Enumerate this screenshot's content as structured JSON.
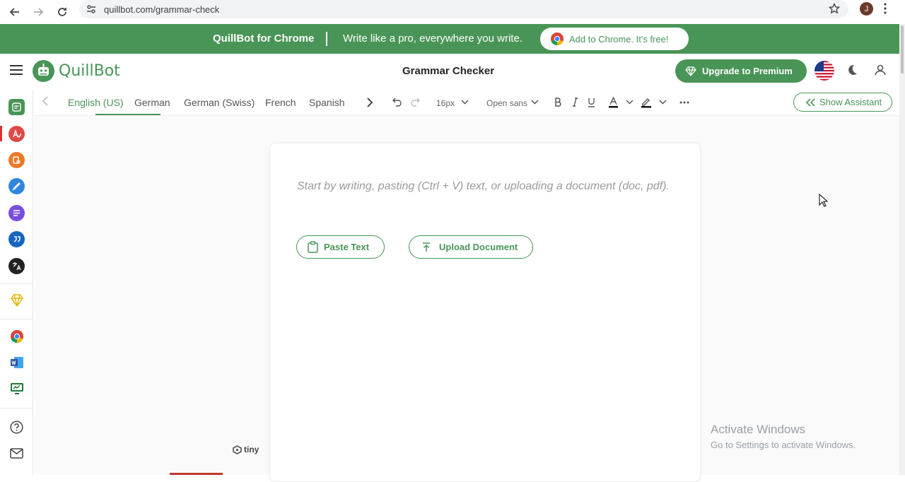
{
  "browser": {
    "url": "quillbot.com/grammar-check",
    "profile_initial": "J"
  },
  "promo": {
    "title": "QuillBot for Chrome",
    "tagline": "Write like a pro, everywhere you write.",
    "cta_label": "Add to Chrome. It's free!"
  },
  "header": {
    "brand": "QuillBot",
    "page_title": "Grammar Checker",
    "upgrade_label": "Upgrade to Premium"
  },
  "sidebar": {
    "items": [
      {
        "icon": "paraphraser-icon",
        "color": "#499557"
      },
      {
        "icon": "grammar-checker-icon",
        "color": "#e04848"
      },
      {
        "icon": "plagiarism-checker-icon",
        "color": "#ea7a27"
      },
      {
        "icon": "co-writer-icon",
        "color": "#2f86e0"
      },
      {
        "icon": "summarizer-icon",
        "color": "#7a4ee0"
      },
      {
        "icon": "citation-generator-icon",
        "color": "#1565c0"
      },
      {
        "icon": "translator-icon",
        "color": "#222222"
      },
      {
        "icon": "premium-gem-icon",
        "color": "#e7b400"
      },
      {
        "icon": "chrome-extension-icon",
        "color": "#e04848"
      },
      {
        "icon": "word-addin-icon",
        "color": "#2b579a"
      },
      {
        "icon": "desktop-app-icon",
        "color": "#1e7b34"
      },
      {
        "icon": "help-icon",
        "color": "#444444"
      },
      {
        "icon": "mail-icon",
        "color": "#444444"
      }
    ]
  },
  "toolbar": {
    "languages": [
      "English (US)",
      "German",
      "German (Swiss)",
      "French",
      "Spanish"
    ],
    "active_language": "English (US)",
    "font_size": "16px",
    "font_family": "Open sans",
    "show_assistant_label": "Show Assistant"
  },
  "editor": {
    "placeholder": "Start by writing, pasting (Ctrl + V) text, or uploading a document (doc, pdf).",
    "paste_label": "Paste Text",
    "upload_label": "Upload Document",
    "tiny_label": "tiny"
  },
  "watermark": {
    "line1": "Activate Windows",
    "line2": "Go to Settings to activate Windows."
  },
  "colors": {
    "brand_green": "#499557"
  }
}
